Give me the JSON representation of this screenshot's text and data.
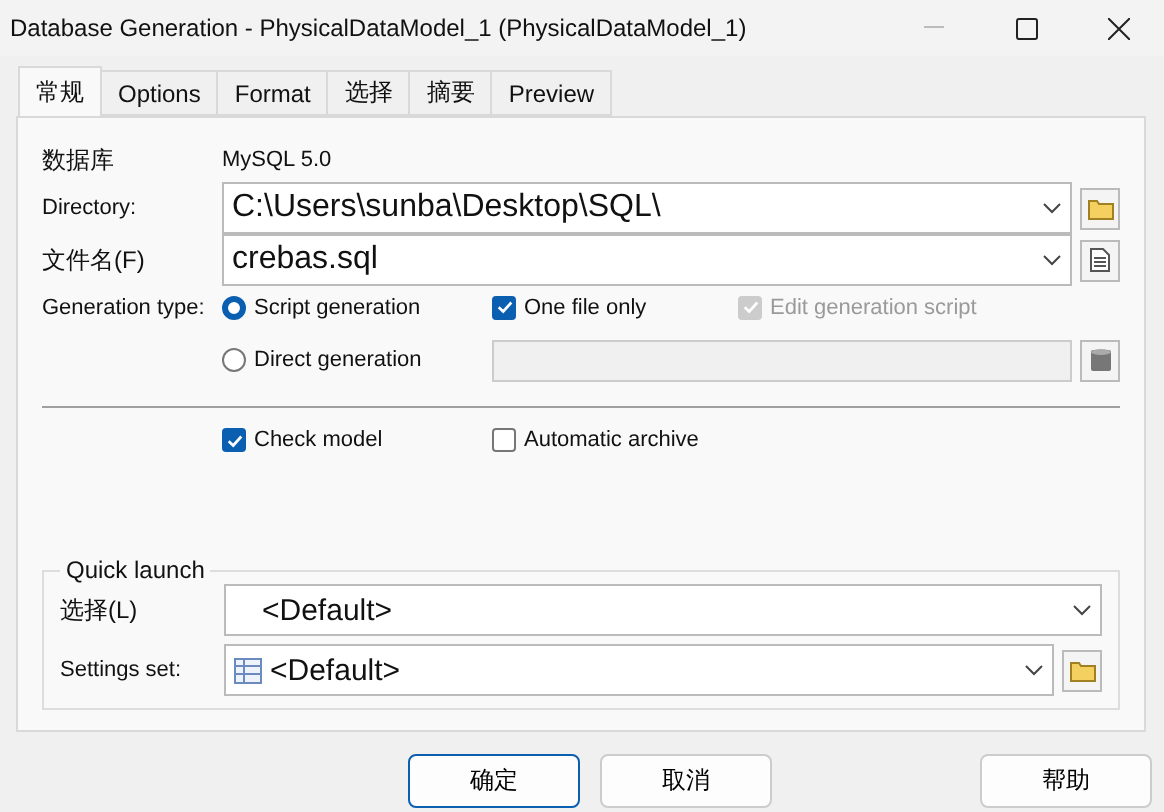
{
  "window": {
    "title": "Database Generation - PhysicalDataModel_1 (PhysicalDataModel_1)"
  },
  "tabs": [
    {
      "label": "常规",
      "selected": true
    },
    {
      "label": "Options",
      "selected": false
    },
    {
      "label": "Format",
      "selected": false
    },
    {
      "label": "选择",
      "selected": false
    },
    {
      "label": "摘要",
      "selected": false
    },
    {
      "label": "Preview",
      "selected": false
    }
  ],
  "database": {
    "label": "数据库",
    "value": "MySQL 5.0"
  },
  "directory": {
    "label": "Directory:",
    "value": "C:\\Users\\sunba\\Desktop\\SQL\\"
  },
  "file_name": {
    "label": "文件名(F)",
    "value": "crebas.sql"
  },
  "generation_type": {
    "label": "Generation type:",
    "options": [
      {
        "label": "Script generation",
        "selected": true
      },
      {
        "label": "Direct generation",
        "selected": false
      }
    ]
  },
  "one_file_only": {
    "label": "One file only",
    "checked": true,
    "disabled": false
  },
  "edit_generation_script": {
    "label": "Edit generation script",
    "checked": true,
    "disabled": true
  },
  "check_model": {
    "label": "Check model",
    "checked": true
  },
  "automatic_archive": {
    "label": "Automatic archive",
    "checked": false
  },
  "quick_launch": {
    "title": "Quick launch",
    "selection_label": "选择(L)",
    "selection_value": "<Default>",
    "settings_label": "Settings set:",
    "settings_value": "<Default>"
  },
  "buttons": [
    {
      "label": "确定",
      "default": true
    },
    {
      "label": "取消",
      "default": false
    },
    {
      "label": "帮助",
      "default": false
    }
  ]
}
